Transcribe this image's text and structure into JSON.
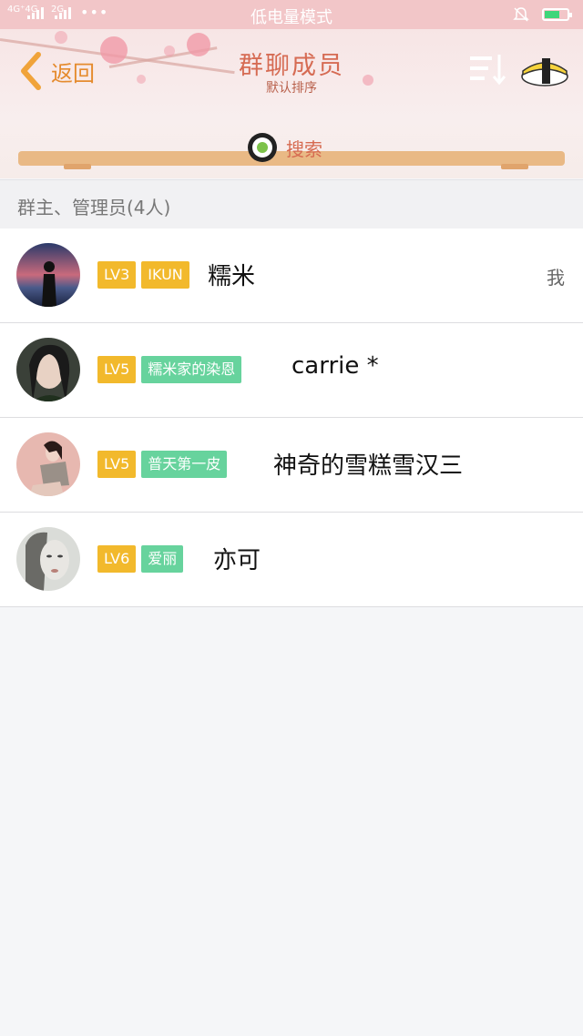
{
  "status_bar": {
    "signal_text": "4G⁺4G",
    "network2": "2G",
    "dots": "•••",
    "mode": "低电量模式",
    "colors": {
      "background": "#f2c6c8",
      "battery_fill": "#3fd67a"
    }
  },
  "header": {
    "back_label": "返回",
    "title": "群聊成员",
    "subtitle": "默认排序",
    "search_label": "搜索",
    "icons": [
      "back-chevron-icon",
      "sort-icon",
      "sushi-icon",
      "sushi-roll-icon"
    ]
  },
  "section": {
    "label": "群主、管理员(4人)"
  },
  "members": [
    {
      "level": "LV3",
      "title": "IKUN",
      "title_color": "#f2b92c",
      "name": "糯米",
      "tag": "我"
    },
    {
      "level": "LV5",
      "title": "糯米家的染恩",
      "title_color": "#67d39d",
      "name": "carrie *",
      "tag": ""
    },
    {
      "level": "LV5",
      "title": "普天第一皮",
      "title_color": "#67d39d",
      "name": "神奇的雪糕雪汉三",
      "tag": ""
    },
    {
      "level": "LV6",
      "title": "爱丽",
      "title_color": "#67d39d",
      "name": "亦可",
      "tag": ""
    }
  ]
}
